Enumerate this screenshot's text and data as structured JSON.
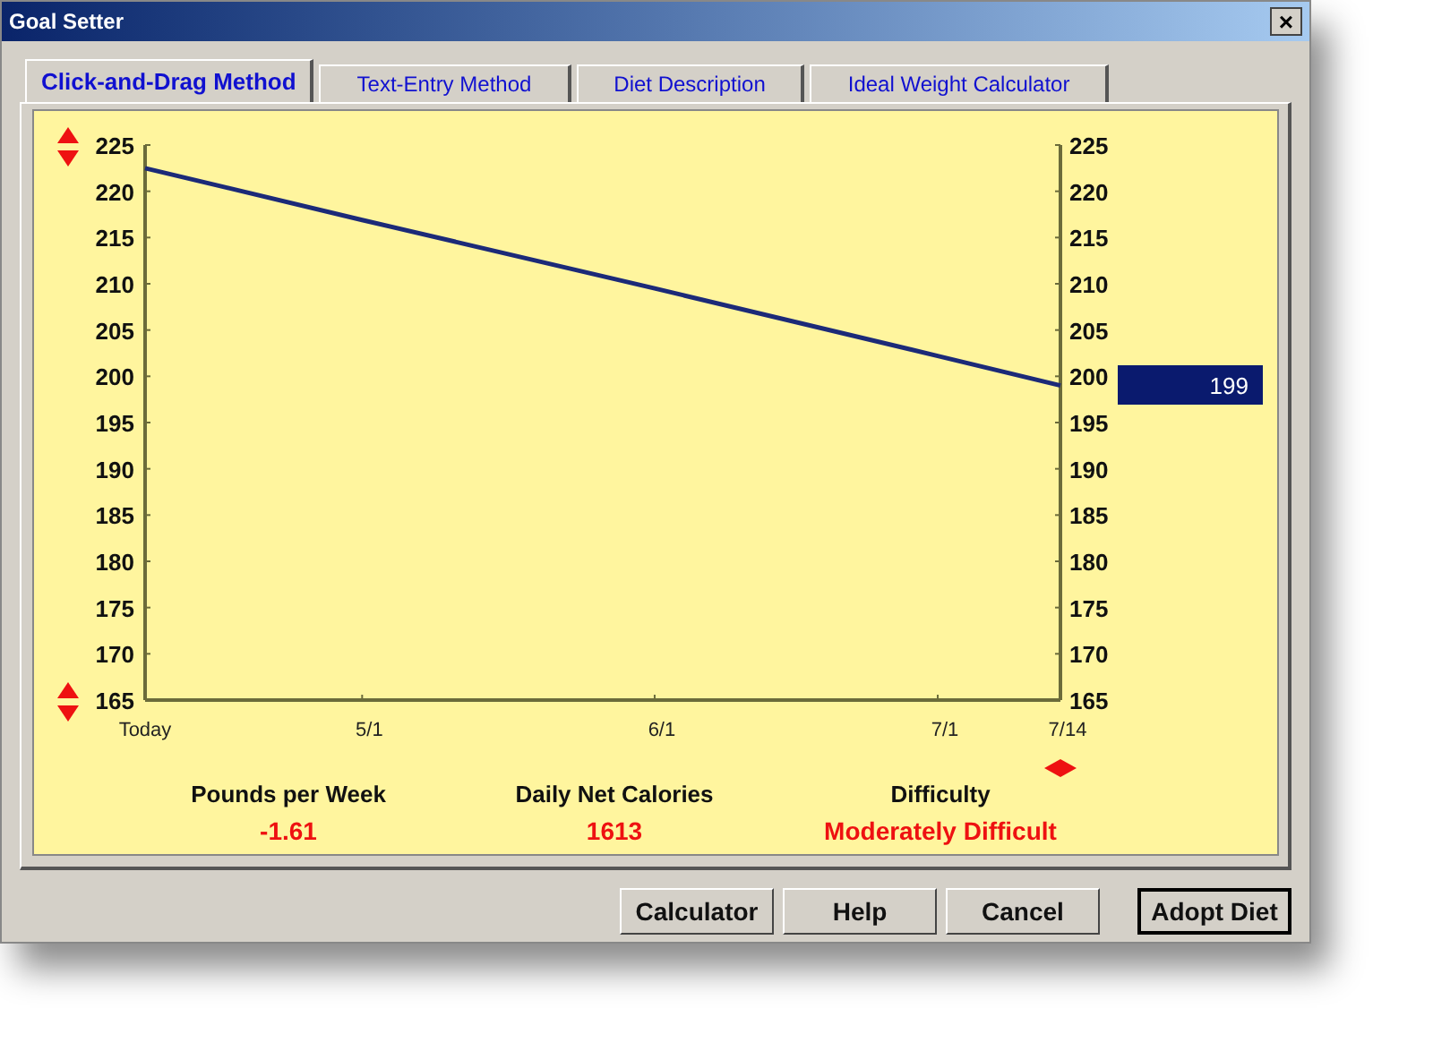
{
  "window": {
    "title": "Goal Setter",
    "close": "×"
  },
  "tabs": [
    {
      "label": "Click-and-Drag Method",
      "selected": true
    },
    {
      "label": "Text-Entry Method",
      "selected": false
    },
    {
      "label": "Diet Description",
      "selected": false
    },
    {
      "label": "Ideal Weight Calculator",
      "selected": false
    }
  ],
  "chart": {
    "value_box": "199",
    "left_axis_labels": [
      "225",
      "220",
      "215",
      "210",
      "205",
      "200",
      "195",
      "190",
      "185",
      "180",
      "175",
      "170",
      "165"
    ],
    "right_axis_labels": [
      "225",
      "220",
      "215",
      "210",
      "205",
      "200",
      "195",
      "190",
      "185",
      "180",
      "175",
      "170",
      "165"
    ],
    "chart_data": {
      "type": "line",
      "categories": [
        "Today",
        "5/1",
        "6/1",
        "7/1",
        "7/14"
      ],
      "series": [
        {
          "color": "#1c2a78",
          "values": [
            222.5,
            216.9,
            209.5,
            202.2,
            199
          ]
        }
      ],
      "ylim": [
        165,
        225
      ],
      "yticks": [
        165,
        170,
        175,
        180,
        185,
        190,
        195,
        200,
        205,
        210,
        215,
        220,
        225
      ]
    }
  },
  "stats": [
    {
      "label": "Pounds per Week",
      "value": "-1.61"
    },
    {
      "label": "Daily Net Calories",
      "value": "1613"
    },
    {
      "label": "Difficulty",
      "value": "Moderately Difficult"
    }
  ],
  "buttons": [
    {
      "label": "Calculator",
      "default": false
    },
    {
      "label": "Help",
      "default": false
    },
    {
      "label": "Cancel",
      "default": false
    },
    {
      "label": "Adopt Diet",
      "default": true
    }
  ]
}
